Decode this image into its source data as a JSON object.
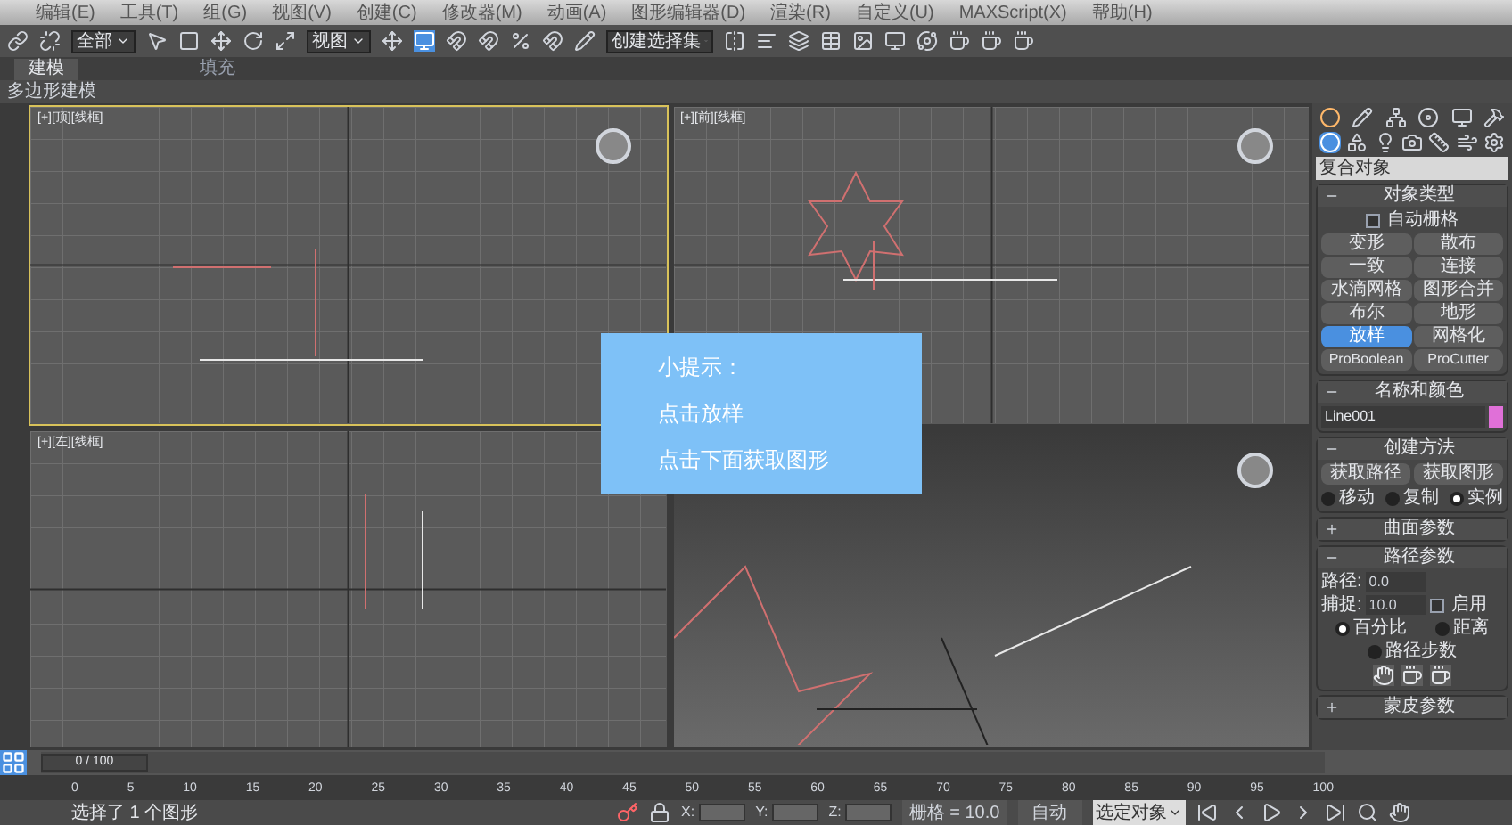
{
  "menu_bar": [
    "编辑(E)",
    "工具(T)",
    "组(G)",
    "视图(V)",
    "创建(C)",
    "修改器(M)",
    "动画(A)",
    "图形编辑器(D)",
    "渲染(R)",
    "自定义(U)",
    "MAXScript(X)",
    "帮助(H)"
  ],
  "toolbar": {
    "selection_filter": "全部",
    "coordinate_system": "视图",
    "selection_set": "创建选择集"
  },
  "ribbon_tabs": [
    {
      "label": "建模",
      "selected": true
    },
    {
      "label": "填充",
      "selected": false
    }
  ],
  "ribbon_panel": "多边形建模",
  "viewports": [
    {
      "kind": "top",
      "label": "[+][顶][线框]",
      "selected": true
    },
    {
      "kind": "front",
      "label": "[+][前][线框]",
      "selected": false
    },
    {
      "kind": "left",
      "label": "[+][左][线框]",
      "selected": false
    },
    {
      "kind": "perspective",
      "selected": false
    }
  ],
  "tip": {
    "lines": [
      "小提示：",
      "点击放样",
      "点击下面获取图形"
    ]
  },
  "command_panel": {
    "category": "复合对象",
    "rollouts": [
      {
        "kind": "buttons",
        "title": "对象类型",
        "expanded": true,
        "checkbox": {
          "label": "自动栅格",
          "checked": false
        },
        "buttons": [
          {
            "label": "变形",
            "selected": false
          },
          {
            "label": "散布",
            "selected": false
          },
          {
            "label": "一致",
            "selected": false
          },
          {
            "label": "连接",
            "selected": false
          },
          {
            "label": "水滴网格",
            "selected": false
          },
          {
            "label": "图形合并",
            "selected": false
          },
          {
            "label": "布尔",
            "selected": false
          },
          {
            "label": "地形",
            "selected": false
          },
          {
            "label": "放样",
            "selected": true
          },
          {
            "label": "网格化",
            "selected": false
          },
          {
            "label": "ProBoolean",
            "selected": false
          },
          {
            "label": "ProCutter",
            "selected": false
          }
        ]
      },
      {
        "kind": "name",
        "title": "名称和颜色",
        "expanded": true,
        "name": "Line001",
        "color": "#e070d8"
      },
      {
        "kind": "method",
        "title": "创建方法",
        "expanded": true,
        "buttons": [
          {
            "label": "获取路径",
            "selected": false
          },
          {
            "label": "获取图形",
            "selected": false
          }
        ],
        "radios": [
          {
            "label": "移动",
            "selected": false
          },
          {
            "label": "复制",
            "selected": false
          },
          {
            "label": "实例",
            "selected": true
          }
        ]
      },
      {
        "kind": "empty",
        "title": "曲面参数",
        "expanded": false
      },
      {
        "kind": "path",
        "title": "路径参数",
        "expanded": true,
        "fields": [
          {
            "label": "路径:",
            "value": "0.0"
          },
          {
            "label": "捕捉:",
            "value": "10.0"
          }
        ],
        "checkbox": {
          "label": "启用",
          "checked": false
        },
        "radios": [
          {
            "label": "百分比",
            "selected": true
          },
          {
            "label": "距离",
            "selected": false
          },
          {
            "label": "路径步数",
            "selected": false
          }
        ]
      },
      {
        "kind": "empty",
        "title": "蒙皮参数",
        "expanded": false
      }
    ]
  },
  "timeline": {
    "frame": "0 / 100",
    "level": 0,
    "ticks": [
      "0",
      "5",
      "10",
      "15",
      "20",
      "25",
      "30",
      "35",
      "40",
      "45",
      "50",
      "55",
      "60",
      "65",
      "70",
      "75",
      "80",
      "85",
      "90",
      "95",
      "100"
    ]
  },
  "status_bar": {
    "message": "选择了 1 个图形",
    "coords": [
      "X:",
      "Y:",
      "Z:"
    ],
    "grid": "栅格 = 10.0",
    "auto_key": "自动",
    "key_filter": "选定对象"
  }
}
